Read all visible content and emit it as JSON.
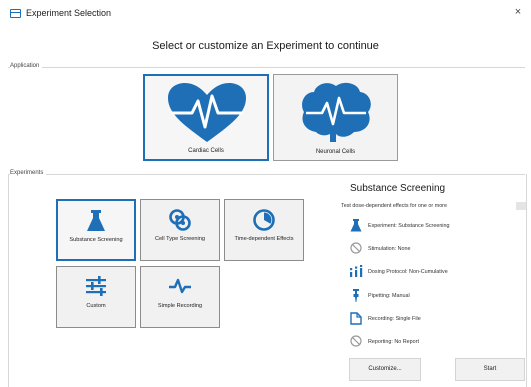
{
  "window": {
    "title": "Experiment Selection",
    "close_glyph": "×"
  },
  "heading": "Select or customize an Experiment to continue",
  "application": {
    "group_label": "Application",
    "tiles": [
      {
        "label": "Cardiac Cells",
        "icon": "heart-icon",
        "selected": true
      },
      {
        "label": "Neuronal Cells",
        "icon": "brain-icon",
        "selected": false
      }
    ]
  },
  "experiments": {
    "group_label": "Experiments",
    "tiles": [
      {
        "label": "Substance Screening",
        "icon": "flask-icon",
        "selected": true
      },
      {
        "label": "Cell Type Screening",
        "icon": "cells-icon",
        "selected": false
      },
      {
        "label": "Time-dependent Effects",
        "icon": "clock-icon",
        "selected": false
      },
      {
        "label": "Custom",
        "icon": "sliders-icon",
        "selected": false
      },
      {
        "label": "Simple Recording",
        "icon": "waveform-icon",
        "selected": false
      }
    ]
  },
  "details": {
    "title": "Substance Screening",
    "subtitle": "Test dose-dependent effects for one or more",
    "rows": [
      {
        "icon": "flask-icon",
        "text": "Experiment: Substance Screening"
      },
      {
        "icon": "blocked-icon",
        "text": "Stimulation: None"
      },
      {
        "icon": "dosing-icon",
        "text": "Dosing Protocol: Non-Cumulative"
      },
      {
        "icon": "pipette-icon",
        "text": "Pipetting: Manual"
      },
      {
        "icon": "file-icon",
        "text": "Recording: Single File"
      },
      {
        "icon": "blocked-icon",
        "text": "Reporting: No Report"
      }
    ]
  },
  "buttons": {
    "customize": "Customize...",
    "start": "Start"
  },
  "colors": {
    "accent": "#1f6fb7",
    "tile_bg": "#f1f1f1",
    "tile_border": "#8c8c8c",
    "muted_icon": "#9a9a9a"
  }
}
